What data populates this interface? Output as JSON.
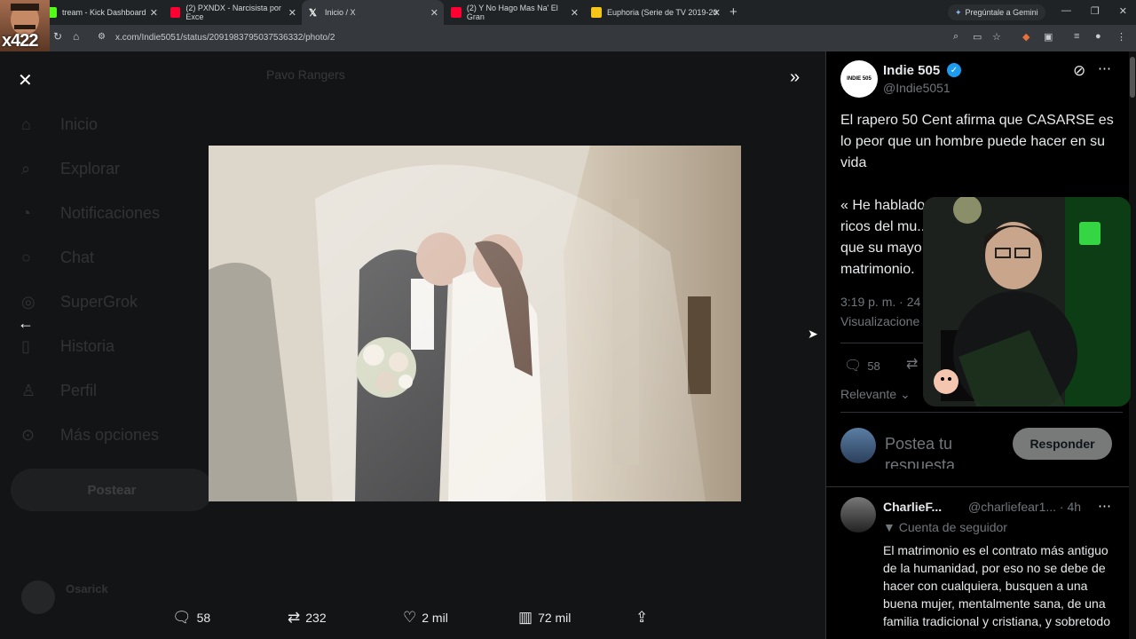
{
  "browser": {
    "tabs": [
      {
        "label": "tream - Kick Dashboard",
        "color": "#53fc18",
        "active": false
      },
      {
        "label": "(2) PXNDX - Narcisista por Exce",
        "color": "#ff0033",
        "active": false
      },
      {
        "label": "Inicio / X",
        "color": "#ffffff",
        "active": true
      },
      {
        "label": "(2) Y No Hago Mas Na' El Gran",
        "color": "#ff0033",
        "active": false
      },
      {
        "label": "Euphoria (Serie de TV 2019-20",
        "color": "#f5c518",
        "active": false
      }
    ],
    "gemini_label": "Pregúntale a Gemini",
    "url": "x.com/Indie5051/status/2091983795037536332/photo/2"
  },
  "streamer": {
    "tag": "x422"
  },
  "sidebar_ghost": [
    "Inicio",
    "Explorar",
    "Notificaciones",
    "Chat",
    "SuperGrok",
    "Historia",
    "Perfil",
    "Más opciones"
  ],
  "sidebar_post_label": "Postear",
  "ghost_header": "Pavo Rangers",
  "ghost_user": "Osarick",
  "media_actions": {
    "replies": "58",
    "reposts": "232",
    "likes": "2 mil",
    "views": "72 mil"
  },
  "tweet": {
    "avatar_text": "INDIE 505",
    "author": "Indie 505",
    "handle": "@Indie5051",
    "text": "El rapero 50 Cent afirma que CASARSE es lo peor que un hombre puede hacer en su vida",
    "quote": "« He hablado ...\nricos del mu...\nque su mayo...\nmatrimonio.",
    "time": "3:19 p. m. · 24",
    "views_label": "Visualizacione",
    "replies": "58",
    "sort_label": "Relevante",
    "reply_placeholder": "Postea tu respuesta",
    "reply_button": "Responder"
  },
  "comment": {
    "name": "CharlieF...",
    "handle": "@charliefear1... · 4h",
    "badge": "Cuenta de seguidor",
    "text": "El matrimonio es el contrato más antiguo de la humanidad, por eso no se debe de hacer con cualquiera, busquen a una buena mujer, mentalmente sana, de una familia tradicional y cristiana, y sobretodo"
  },
  "colors": {
    "accent": "#1d9bf0",
    "kick_green": "#53fc18"
  }
}
